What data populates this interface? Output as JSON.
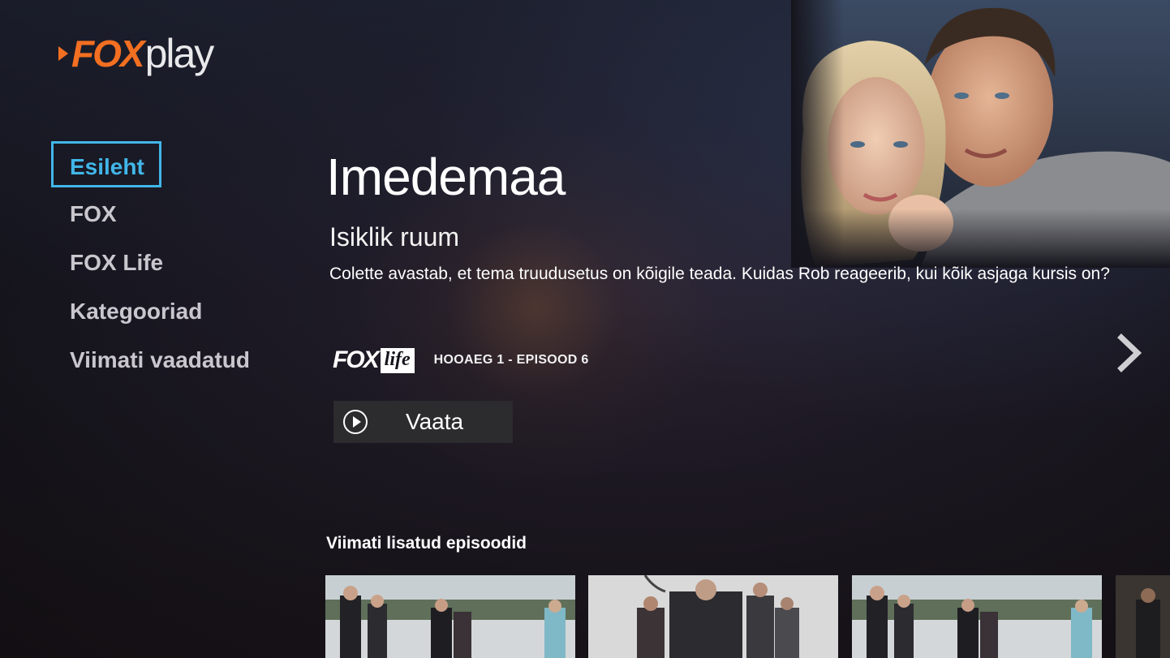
{
  "logo": {
    "fox": "FOX",
    "play": "play"
  },
  "nav": {
    "items": [
      {
        "label": "Esileht",
        "active": true
      },
      {
        "label": "FOX",
        "active": false
      },
      {
        "label": "FOX Life",
        "active": false
      },
      {
        "label": "Kategooriad",
        "active": false
      },
      {
        "label": "Viimati vaadatud",
        "active": false
      }
    ]
  },
  "hero": {
    "title": "Imedemaa",
    "subtitle": "Isiklik ruum",
    "description": "Colette avastab, et tema truudusetus on kõigile teada. Kuidas Rob reageerib, kui kõik asjaga kursis on?",
    "channel_logo": {
      "fox": "FOX",
      "life": "life"
    },
    "episode": "HOOAEG 1 - EPISOOD 6",
    "watch_label": "Vaata"
  },
  "recent": {
    "title": "Viimati lisatud episoodid"
  },
  "colors": {
    "accent": "#41b6e8",
    "brand": "#f36f21",
    "button_bg": "#2c2b2e"
  },
  "icons": {
    "play": "play-circle-icon",
    "next": "chevron-right-icon"
  }
}
